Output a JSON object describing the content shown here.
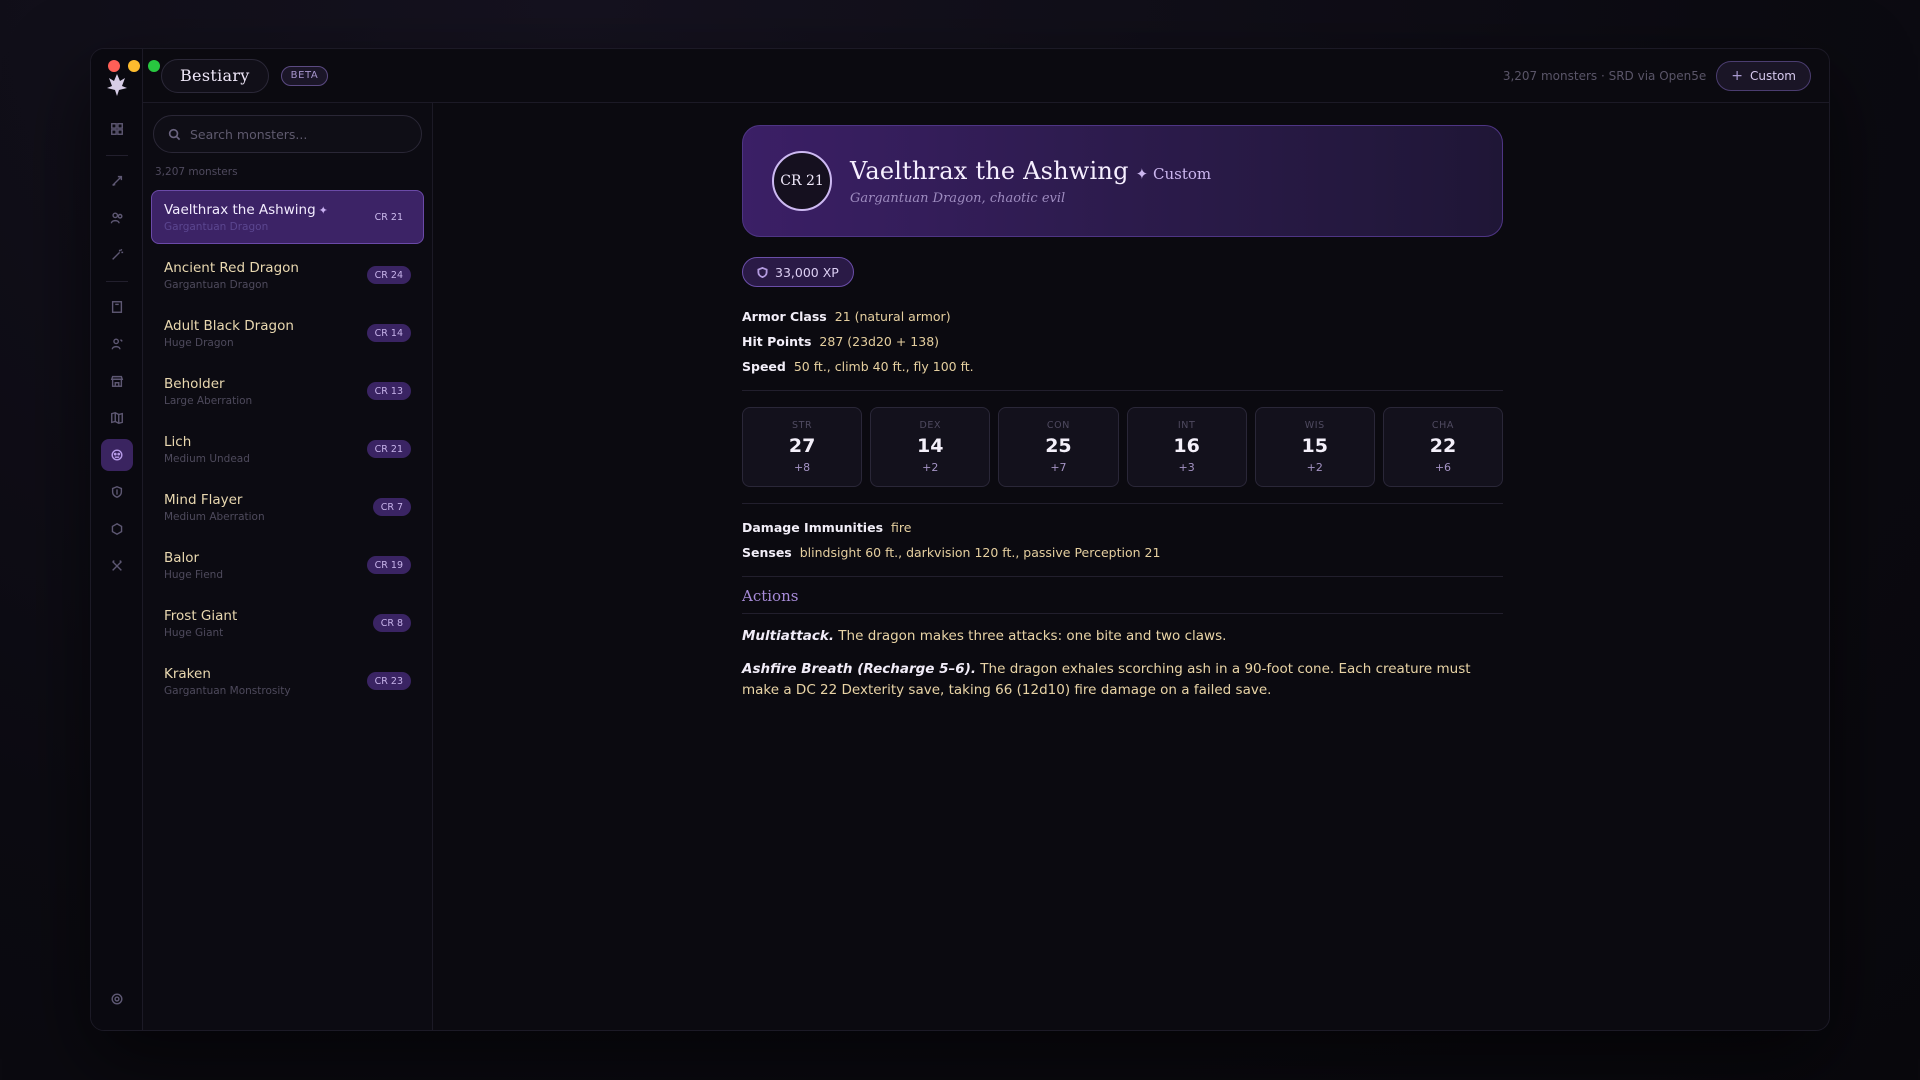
{
  "app": {
    "title": "Bestiary",
    "badge": "BETA"
  },
  "topbar": {
    "meta": "3,207 monsters · SRD via Open5e",
    "custom_button": "Custom"
  },
  "rail": {
    "icons": [
      "grid-icon",
      "quill-icon",
      "users-icon",
      "wand-icon",
      "book-icon",
      "npc-icon",
      "shop-icon",
      "map-icon",
      "monster-face-icon",
      "shield-icon",
      "hexagon-icon",
      "tools-icon"
    ],
    "active": "monster-face-icon"
  },
  "sidebar": {
    "search_placeholder": "Search monsters...",
    "count": "3,207 monsters",
    "monsters": [
      {
        "name": "Vaelthrax the Ashwing",
        "custom": true,
        "sub": "Gargantuan Dragon",
        "cr": "CR 21",
        "selected": true
      },
      {
        "name": "Ancient Red Dragon",
        "sub": "Gargantuan Dragon",
        "cr": "CR 24"
      },
      {
        "name": "Adult Black Dragon",
        "sub": "Huge Dragon",
        "cr": "CR 14"
      },
      {
        "name": "Beholder",
        "sub": "Large Aberration",
        "cr": "CR 13"
      },
      {
        "name": "Lich",
        "sub": "Medium Undead",
        "cr": "CR 21"
      },
      {
        "name": "Mind Flayer",
        "sub": "Medium Aberration",
        "cr": "CR 7"
      },
      {
        "name": "Balor",
        "sub": "Huge Fiend",
        "cr": "CR 19"
      },
      {
        "name": "Frost Giant",
        "sub": "Huge Giant",
        "cr": "CR 8"
      },
      {
        "name": "Kraken",
        "sub": "Gargantuan Monstrosity",
        "cr": "CR 23"
      }
    ]
  },
  "detail": {
    "cr": "CR 21",
    "name": "Vaelthrax the Ashwing",
    "tag": "✦ Custom",
    "subtitle": "Gargantuan Dragon, chaotic evil",
    "xp": "33,000 XP",
    "armor_class": {
      "label": "Armor Class",
      "value": "21 (natural armor)"
    },
    "hit_points": {
      "label": "Hit Points",
      "value": "287 (23d20 + 138)"
    },
    "speed": {
      "label": "Speed",
      "value": "50 ft., climb 40 ft., fly 100 ft."
    },
    "stats": [
      {
        "label": "STR",
        "value": "27",
        "mod": "+8"
      },
      {
        "label": "DEX",
        "value": "14",
        "mod": "+2"
      },
      {
        "label": "CON",
        "value": "25",
        "mod": "+7"
      },
      {
        "label": "INT",
        "value": "16",
        "mod": "+3"
      },
      {
        "label": "WIS",
        "value": "15",
        "mod": "+2"
      },
      {
        "label": "CHA",
        "value": "22",
        "mod": "+6"
      }
    ],
    "damage_immunities": {
      "label": "Damage Immunities",
      "value": "fire"
    },
    "senses": {
      "label": "Senses",
      "value": "blindsight 60 ft., darkvision 120 ft., passive Perception 21"
    },
    "actions_title": "Actions",
    "actions": [
      {
        "name": "Multiattack.",
        "text": "The dragon makes three attacks: one bite and two claws."
      },
      {
        "name": "Ashfire Breath (Recharge 5–6).",
        "text": "The dragon exhales scorching ash in a 90-foot cone. Each creature must make a DC 22 Dexterity save, taking 66 (12d10) fire damage on a failed save."
      }
    ]
  },
  "colors": {
    "accent": "#3c2366",
    "accent_border": "#6b4aa8",
    "gold_text": "#e9d4a6"
  }
}
